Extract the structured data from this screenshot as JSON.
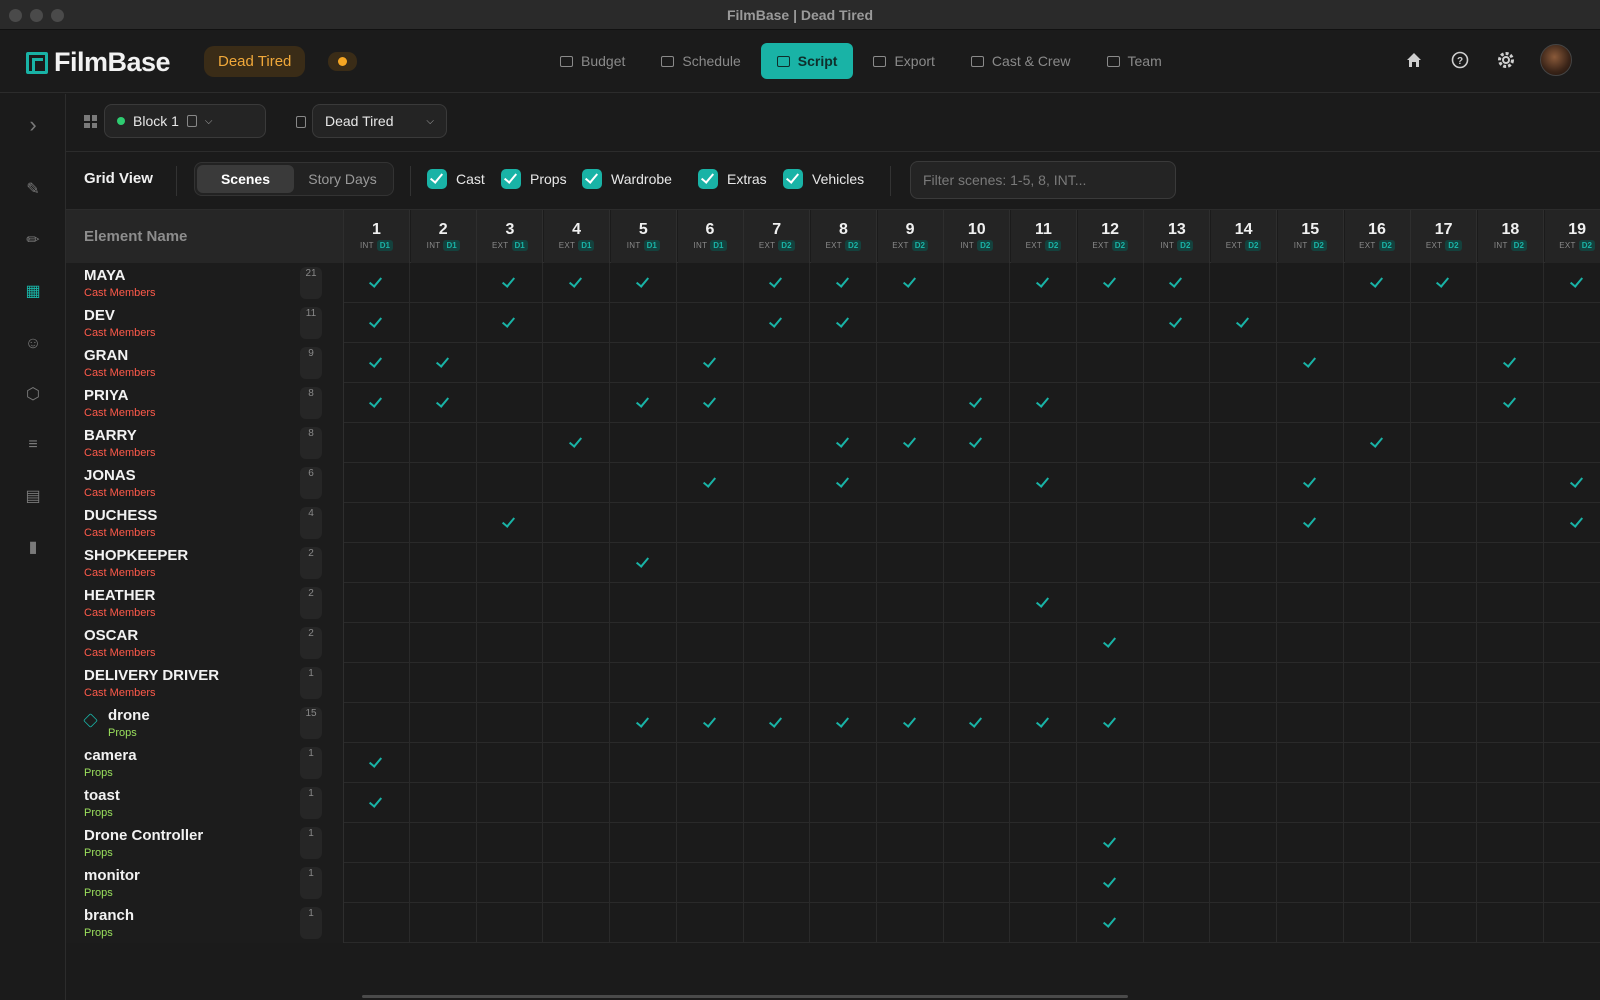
{
  "window": {
    "title": "FilmBase | Dead Tired"
  },
  "brand": {
    "name": "FilmBase",
    "accent": "#19b3a6"
  },
  "project": {
    "name": "Dead Tired",
    "status_color": "#f5a623"
  },
  "nav": {
    "tabs": [
      {
        "label": "Budget",
        "icon": "budget-icon",
        "active": false
      },
      {
        "label": "Schedule",
        "icon": "calendar-icon",
        "active": false
      },
      {
        "label": "Script",
        "icon": "script-icon",
        "active": true
      },
      {
        "label": "Export",
        "icon": "export-icon",
        "active": false
      },
      {
        "label": "Cast & Crew",
        "icon": "people-icon",
        "active": false
      },
      {
        "label": "Team",
        "icon": "chat-icon",
        "active": false
      }
    ],
    "right_icons": [
      "home-icon",
      "help-icon",
      "gear-icon",
      "avatar"
    ]
  },
  "sidebar": {
    "icons": [
      "expand-chevron-icon",
      "script-edit-icon",
      "pencil-icon",
      "grid-icon",
      "people-icon",
      "box-icon",
      "document-icon",
      "clapperboard-icon",
      "film-icon"
    ],
    "active": "grid-icon"
  },
  "toolbar": {
    "block_label": "Block 1",
    "script_label": "Dead Tired"
  },
  "filters": {
    "view_label": "Grid View",
    "segments": [
      "Scenes",
      "Story Days"
    ],
    "active_segment": "Scenes",
    "checkboxes": [
      "Cast",
      "Props",
      "Wardrobe",
      "Extras",
      "Vehicles"
    ],
    "placeholder": "Filter scenes: 1-5, 8, INT..."
  },
  "grid": {
    "name_header": "Element Name",
    "scenes": [
      {
        "n": "1",
        "ie": "INT",
        "day": "D1"
      },
      {
        "n": "2",
        "ie": "INT",
        "day": "D1"
      },
      {
        "n": "3",
        "ie": "EXT",
        "day": "D1"
      },
      {
        "n": "4",
        "ie": "EXT",
        "day": "D1"
      },
      {
        "n": "5",
        "ie": "INT",
        "day": "D1"
      },
      {
        "n": "6",
        "ie": "INT",
        "day": "D1"
      },
      {
        "n": "7",
        "ie": "EXT",
        "day": "D2"
      },
      {
        "n": "8",
        "ie": "EXT",
        "day": "D2"
      },
      {
        "n": "9",
        "ie": "EXT",
        "day": "D2"
      },
      {
        "n": "10",
        "ie": "INT",
        "day": "D2"
      },
      {
        "n": "11",
        "ie": "EXT",
        "day": "D2"
      },
      {
        "n": "12",
        "ie": "EXT",
        "day": "D2"
      },
      {
        "n": "13",
        "ie": "INT",
        "day": "D2"
      },
      {
        "n": "14",
        "ie": "EXT",
        "day": "D2"
      },
      {
        "n": "15",
        "ie": "INT",
        "day": "D2"
      },
      {
        "n": "16",
        "ie": "EXT",
        "day": "D2"
      },
      {
        "n": "17",
        "ie": "EXT",
        "day": "D2"
      },
      {
        "n": "18",
        "ie": "INT",
        "day": "D2"
      },
      {
        "n": "19",
        "ie": "EXT",
        "day": "D2"
      }
    ],
    "rows": [
      {
        "name": "MAYA",
        "type": "Cast Members",
        "count": "21",
        "scenes": [
          1,
          3,
          4,
          5,
          7,
          8,
          9,
          11,
          12,
          13,
          16,
          17,
          19
        ]
      },
      {
        "name": "DEV",
        "type": "Cast Members",
        "count": "11",
        "scenes": [
          1,
          3,
          7,
          8,
          13,
          14
        ]
      },
      {
        "name": "GRAN",
        "type": "Cast Members",
        "count": "9",
        "scenes": [
          1,
          2,
          6,
          15,
          18
        ]
      },
      {
        "name": "PRIYA",
        "type": "Cast Members",
        "count": "8",
        "scenes": [
          1,
          2,
          5,
          6,
          10,
          11,
          18
        ]
      },
      {
        "name": "BARRY",
        "type": "Cast Members",
        "count": "8",
        "scenes": [
          4,
          8,
          9,
          10,
          16
        ]
      },
      {
        "name": "JONAS",
        "type": "Cast Members",
        "count": "6",
        "scenes": [
          6,
          8,
          11,
          15,
          19
        ]
      },
      {
        "name": "DUCHESS",
        "type": "Cast Members",
        "count": "4",
        "scenes": [
          3,
          15,
          19
        ]
      },
      {
        "name": "SHOPKEEPER",
        "type": "Cast Members",
        "count": "2",
        "scenes": [
          5
        ]
      },
      {
        "name": "HEATHER",
        "type": "Cast Members",
        "count": "2",
        "scenes": [
          11
        ]
      },
      {
        "name": "OSCAR",
        "type": "Cast Members",
        "count": "2",
        "scenes": [
          12
        ]
      },
      {
        "name": "DELIVERY DRIVER",
        "type": "Cast Members",
        "count": "1",
        "scenes": []
      },
      {
        "name": "drone",
        "type": "Props",
        "count": "15",
        "icon": "box-icon",
        "scenes": [
          5,
          6,
          7,
          8,
          9,
          10,
          11,
          12
        ]
      },
      {
        "name": "camera",
        "type": "Props",
        "count": "1",
        "scenes": [
          1
        ]
      },
      {
        "name": "toast",
        "type": "Props",
        "count": "1",
        "scenes": [
          1
        ]
      },
      {
        "name": "Drone Controller",
        "type": "Props",
        "count": "1",
        "scenes": [
          12
        ]
      },
      {
        "name": "monitor",
        "type": "Props",
        "count": "1",
        "scenes": [
          12
        ]
      },
      {
        "name": "branch",
        "type": "Props",
        "count": "1",
        "scenes": [
          12
        ]
      }
    ],
    "type_colors": {
      "Cast Members": "#ff5a4a",
      "Props": "#9be15d"
    }
  }
}
